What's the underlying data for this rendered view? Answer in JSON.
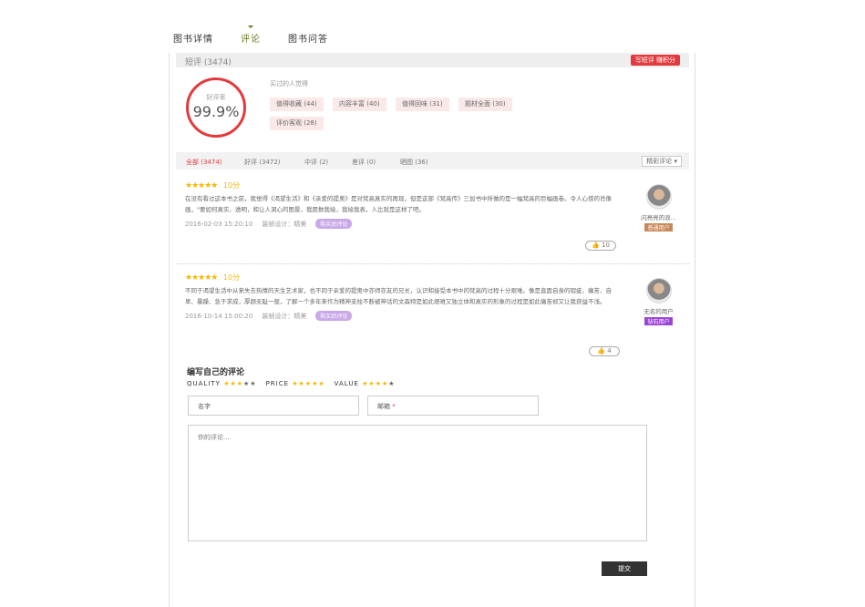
{
  "tabs": [
    "图书详情",
    "评论",
    "图书问答"
  ],
  "short_reviews": {
    "title": "短评",
    "count": "(3474)",
    "write_button": "写短评 赚积分"
  },
  "rating": {
    "label": "好评率",
    "value": "99.9%"
  },
  "buyers_label": "买过的人觉得",
  "tags": [
    "值得收藏 (44)",
    "内容丰富 (40)",
    "值得回味 (31)",
    "题材全面 (30)",
    "评价客观 (28)"
  ],
  "filters": {
    "all": "全部 (3474)",
    "good": "好评 (3472)",
    "medium": "中评 (2)",
    "bad": "差评 (0)",
    "photos": "晒图 (36)",
    "sort": "精彩评论 ▾"
  },
  "reviews": [
    {
      "stars": "★★★★★",
      "score": "10分",
      "text": "在没有看过这本书之前，我觉得《渴望生活》和《亲爱的提奥》是对梵高真实的再现，但是这部《梵高传》三加书中所做的是一幅梵高的巨幅画卷。令人心惊的肖像画，\"要如何真实、透明，和让人洞心的图景，我愿数我绘，我绘我表，人比就是这样了吧。",
      "date": "2016-02-03 15:20:10",
      "binding": "装帧设计：精美",
      "badge": "购买后评论",
      "likes": "10",
      "user": {
        "name": "闪亮亮的浪...",
        "level": "普通用户",
        "level_color": "#c8885a"
      }
    },
    {
      "stars": "★★★★★",
      "score": "10分",
      "text": "不同于渴望生活中从来失去热情的天生艺术家，也不同于亲爱的提奥中亦师亦友的兄长，认识和接受本书中的梵高的过程十分艰难。像是直面自身的瑕疵、痛苦、自卑、暴躁、急于求成，厚颜无耻一般，了解一个多年来作为精神支柱不断被神话的文森特是如此艰难又独立体和真实的形象的过程是如此痛苦却又让我获益不浅。",
      "date": "2016-10-14 15:00:20",
      "binding": "装帧设计：精美",
      "badge": "购买后评论",
      "likes": "4",
      "user": {
        "name": "无名的用户",
        "level": "钻石用户",
        "level_color": "#9b45d6"
      }
    }
  ],
  "write_form": {
    "title": "编写自己的评论",
    "quality_label": "QUALITY",
    "price_label": "PRICE",
    "value_label": "VALUE",
    "quality_stars": 3,
    "price_stars": 5,
    "value_stars": 4,
    "name_label": "名字",
    "email_label": "邮箱",
    "email_required": "*",
    "comment_placeholder": "你的评论...",
    "submit": "提交"
  }
}
